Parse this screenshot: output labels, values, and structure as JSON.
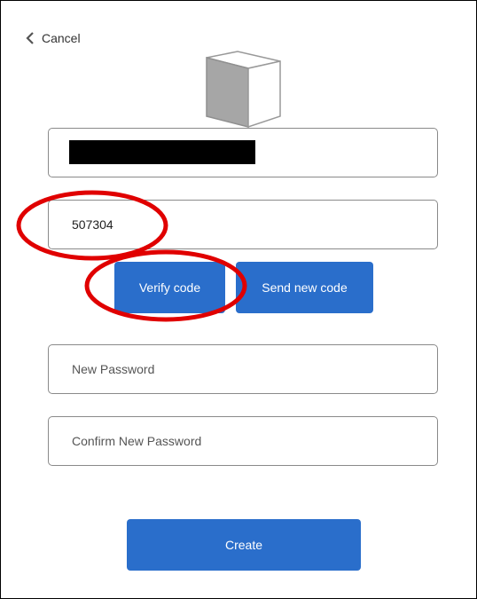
{
  "nav": {
    "cancel_label": "Cancel"
  },
  "logo": {
    "icon": "cube-icon"
  },
  "form": {
    "email": {
      "value": ""
    },
    "code": {
      "value": "507304"
    },
    "new_password": {
      "placeholder": "New Password"
    },
    "confirm_password": {
      "placeholder": "Confirm New Password"
    }
  },
  "buttons": {
    "verify_code_label": "Verify code",
    "send_new_code_label": "Send new code",
    "create_label": "Create"
  },
  "colors": {
    "primary_button": "#2a6ecb",
    "annotation_red": "#e00000"
  }
}
